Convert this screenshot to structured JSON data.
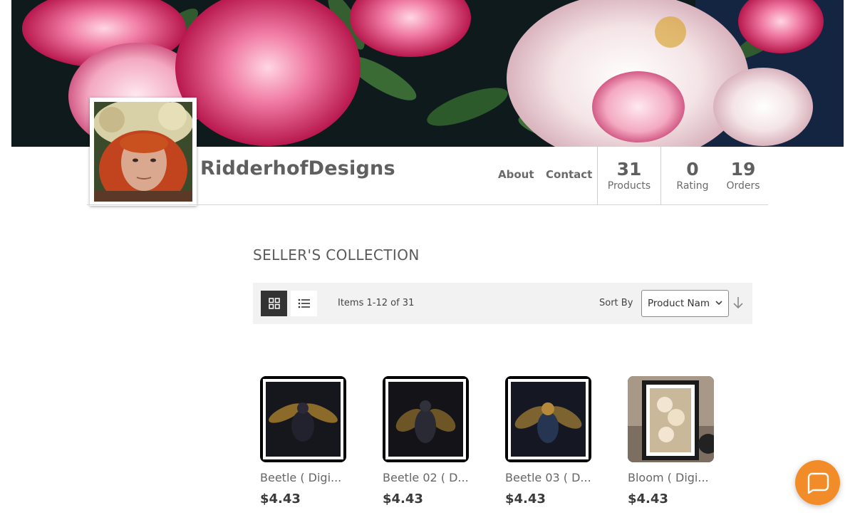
{
  "store": {
    "name": "RidderhofDesigns",
    "nav": {
      "about": "About",
      "contact": "Contact"
    },
    "stats": [
      {
        "value": "31",
        "label": "Products"
      },
      {
        "value": "0",
        "label": "Rating"
      },
      {
        "value": "19",
        "label": "Orders"
      }
    ]
  },
  "collection": {
    "title": "SELLER'S COLLECTION",
    "items_count": "Items 1-12 of 31",
    "sort_label": "Sort By",
    "sort_value": "Product Name",
    "view_modes": [
      "grid-view-icon",
      "list-view-icon"
    ],
    "active_view": "grid"
  },
  "products": [
    {
      "name": "Beetle ( Digi...",
      "price": "$4.43"
    },
    {
      "name": "Beetle 02 ( D...",
      "price": "$4.43"
    },
    {
      "name": "Beetle 03 ( D...",
      "price": "$4.43"
    },
    {
      "name": "Bloom ( Digi...",
      "price": "$4.43"
    }
  ],
  "colors": {
    "accent": "#f28c28",
    "banner_flower": "#e04a7a",
    "text": "#5f5f5f"
  },
  "icons": {
    "chat": "chat-bubble-icon",
    "sort_direction": "arrow-down-icon",
    "select": "chevron-down-icon"
  }
}
